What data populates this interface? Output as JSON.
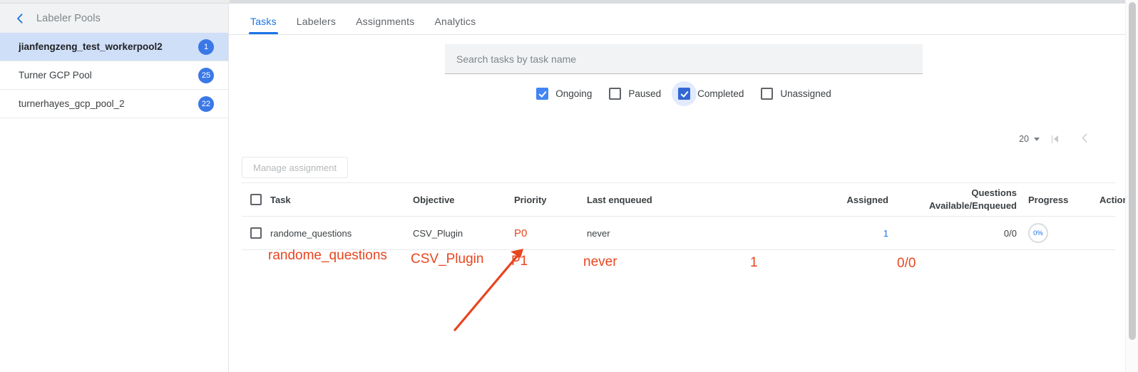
{
  "sidebar": {
    "back_icon": "chevron-left-icon",
    "header_title": "Labeler Pools",
    "items": [
      {
        "label": "jianfengzeng_test_workerpool2",
        "badge": "1",
        "selected": true
      },
      {
        "label": "Turner GCP Pool",
        "badge": "25",
        "selected": false
      },
      {
        "label": "turnerhayes_gcp_pool_2",
        "badge": "22",
        "selected": false
      }
    ]
  },
  "tabs": [
    {
      "label": "Tasks",
      "active": true
    },
    {
      "label": "Labelers",
      "active": false
    },
    {
      "label": "Assignments",
      "active": false
    },
    {
      "label": "Analytics",
      "active": false
    }
  ],
  "search": {
    "placeholder": "Search tasks by task name",
    "value": ""
  },
  "filters": [
    {
      "label": "Ongoing",
      "checked": true,
      "focused": false
    },
    {
      "label": "Paused",
      "checked": false,
      "focused": false
    },
    {
      "label": "Completed",
      "checked": true,
      "focused": true
    },
    {
      "label": "Unassigned",
      "checked": false,
      "focused": false
    }
  ],
  "pagination": {
    "page_size": "20",
    "page_size_caret": "caret-down-icon",
    "first_page_icon": "first-page-icon",
    "prev_page_icon": "chevron-left-icon"
  },
  "toolbar": {
    "manage_assignment_label": "Manage assignment",
    "manage_assignment_disabled": true
  },
  "table": {
    "columns": [
      "Task",
      "Objective",
      "Priority",
      "Last enqueued",
      "Assigned",
      "Questions",
      "Available/Enqueued",
      "Progress",
      "Actions"
    ],
    "rows": [
      {
        "task": "randome_questions",
        "objective": "CSV_Plugin",
        "priority": "P0",
        "last_enqueued": "never",
        "assigned": "1",
        "questions": "0/0",
        "progress": "0%",
        "actions": ""
      }
    ]
  },
  "annotation": {
    "color": "#e8451f",
    "task": "randome_questions",
    "objective": "CSV_Plugin",
    "priority": "P1",
    "last_enqueued": "never",
    "assigned": "1",
    "questions": "0/0",
    "arrow_icon": "arrow-up-right-icon"
  },
  "scrollbar": {
    "orientation": "vertical"
  }
}
